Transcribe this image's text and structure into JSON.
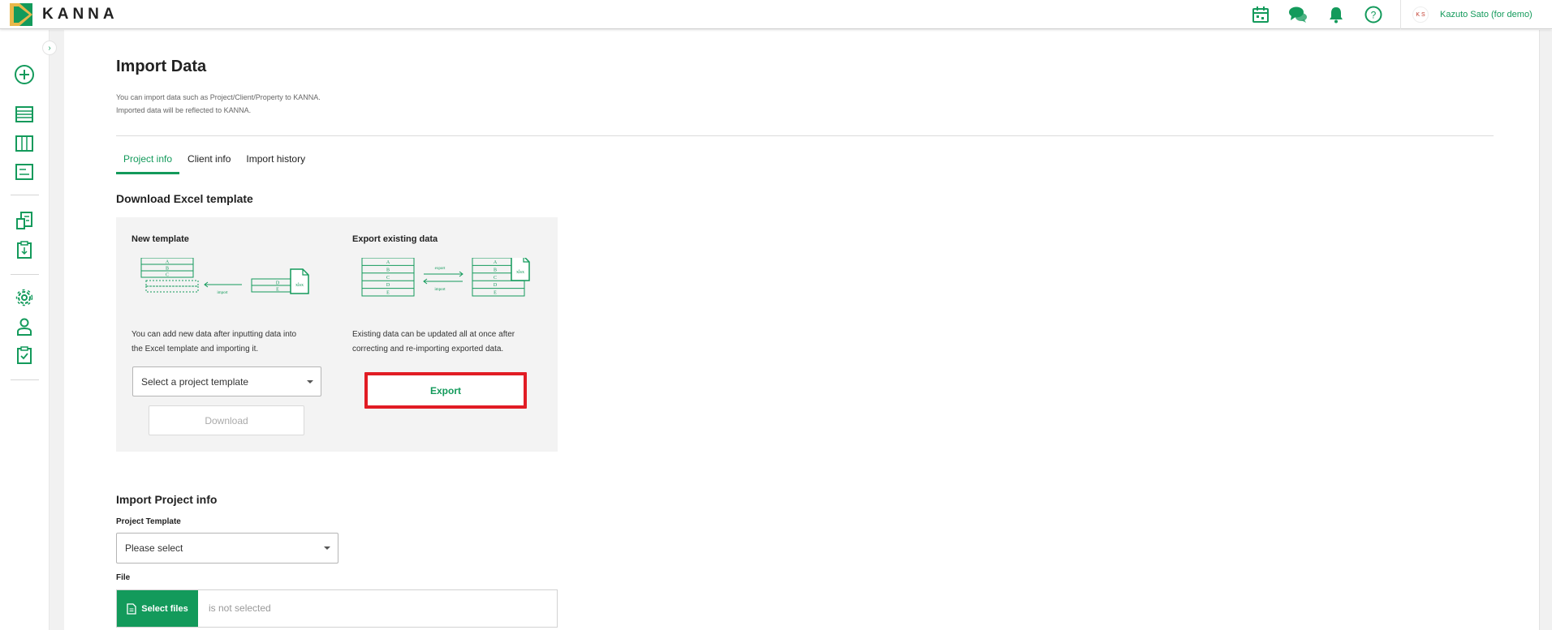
{
  "app": {
    "brand": "KANNA",
    "accent": "#139a5b",
    "highlight": "#e11c24"
  },
  "header": {
    "icons": [
      "calendar-icon",
      "chat-icon",
      "bell-icon",
      "help-icon"
    ],
    "user_initials": "K S",
    "user_name": "Kazuto Sato (for demo)"
  },
  "sidebar": {
    "collapse_glyph": "›",
    "items": [
      "add-circle-icon",
      "list-icon",
      "columns-icon",
      "board-icon",
      "documents-icon",
      "clipboard-download-icon",
      "settings-icon",
      "user-icon",
      "clipboard-check-icon"
    ]
  },
  "page": {
    "title": "Import Data",
    "desc_line1": "You can import data such as Project/Client/Property to KANNA.",
    "desc_line2": "Imported data will be reflected to KANNA."
  },
  "tabs": [
    {
      "label": "Project info",
      "active": true
    },
    {
      "label": "Client info",
      "active": false
    },
    {
      "label": "Import history",
      "active": false
    }
  ],
  "download": {
    "section_title": "Download Excel template",
    "new_template": {
      "title": "New template",
      "desc_line1": "You can add new data after inputting data into",
      "desc_line2": "the Excel template and importing it.",
      "select_value": "Select a project template",
      "button": "Download",
      "illus_rows": [
        "A",
        "B",
        "C"
      ],
      "illus_file_rows": [
        "D",
        "E"
      ],
      "illus_file_ext": "xlsx",
      "illus_arrow_label": "import"
    },
    "export_existing": {
      "title": "Export existing data",
      "desc_line1": "Existing data can be updated all at once after",
      "desc_line2": "correcting and re-importing exported data.",
      "button": "Export",
      "illus_rows": [
        "A",
        "B",
        "C",
        "D",
        "E"
      ],
      "illus_file_ext": "xlsx",
      "illus_export_label": "export",
      "illus_import_label": "import"
    }
  },
  "import": {
    "section_title": "Import Project info",
    "template_label": "Project Template",
    "template_value": "Please select",
    "file_label": "File",
    "file_button": "Select files",
    "file_status": "is not selected"
  }
}
